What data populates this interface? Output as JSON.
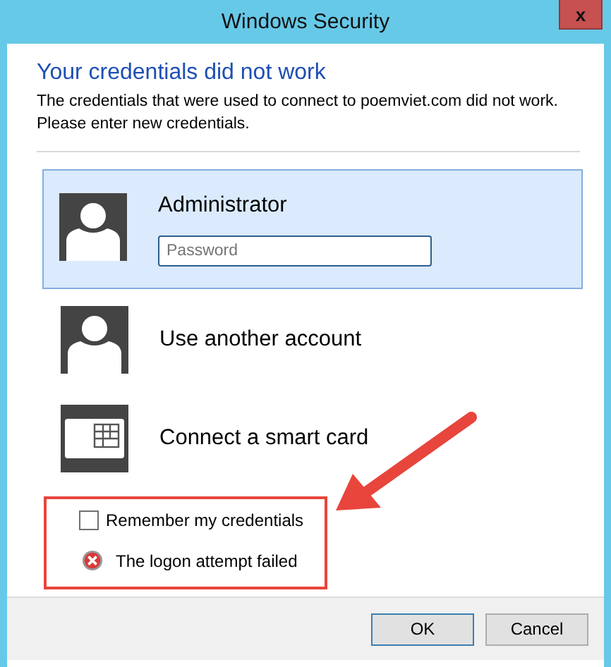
{
  "window": {
    "title": "Windows Security",
    "close": "x"
  },
  "heading": "Your credentials did not work",
  "message": "The credentials that were used to connect to poemviet.com did not work. Please enter new credentials.",
  "accounts": [
    {
      "kind": "user",
      "name": "Administrator",
      "selected": true,
      "password": {
        "placeholder": "Password"
      }
    },
    {
      "kind": "user",
      "name": "Use another account",
      "selected": false
    },
    {
      "kind": "smartcard",
      "name": "Connect a smart card",
      "selected": false
    }
  ],
  "remember": {
    "label": "Remember my credentials",
    "checked": false
  },
  "error": "The logon attempt failed",
  "buttons": [
    {
      "label": "OK",
      "default": true
    },
    {
      "label": "Cancel",
      "default": false
    }
  ]
}
